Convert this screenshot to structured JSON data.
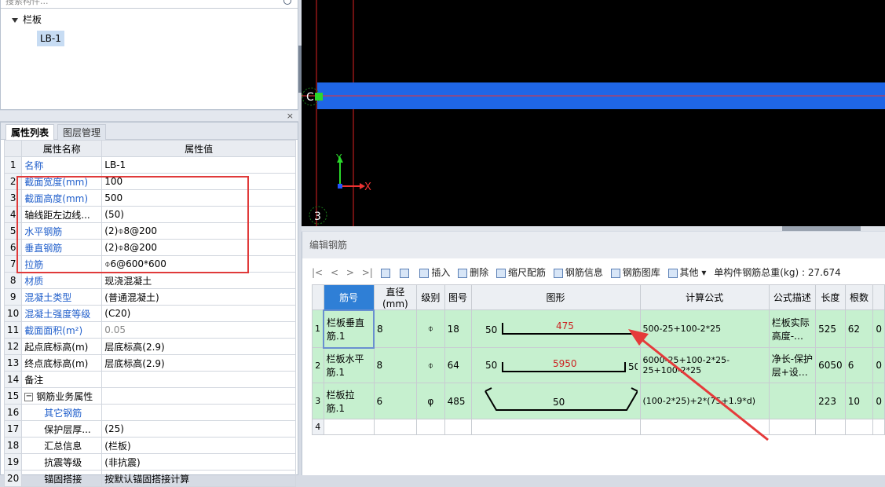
{
  "tree": {
    "search_placeholder": "搜索构件...",
    "root_label": "栏板",
    "child_label": "LB-1"
  },
  "props": {
    "tab_properties": "属性列表",
    "tab_layers": "图层管理",
    "col_name": "属性名称",
    "col_value": "属性值",
    "rows": [
      {
        "n": "1",
        "name": "名称",
        "value": "LB-1",
        "style": "blue"
      },
      {
        "n": "2",
        "name": "截面宽度(mm)",
        "value": "100",
        "style": "blue"
      },
      {
        "n": "3",
        "name": "截面高度(mm)",
        "value": "500",
        "style": "blue"
      },
      {
        "n": "4",
        "name": "轴线距左边线...",
        "value": "(50)",
        "style": ""
      },
      {
        "n": "5",
        "name": "水平钢筋",
        "value": "(2)⌽8@200",
        "style": "blue"
      },
      {
        "n": "6",
        "name": "垂直钢筋",
        "value": "(2)⌽8@200",
        "style": "blue"
      },
      {
        "n": "7",
        "name": "拉筋",
        "value": "⌽6@600*600",
        "style": "blue"
      },
      {
        "n": "8",
        "name": "材质",
        "value": "现浇混凝土",
        "style": "blue"
      },
      {
        "n": "9",
        "name": "混凝土类型",
        "value": "(普通混凝土)",
        "style": "blue"
      },
      {
        "n": "10",
        "name": "混凝土强度等级",
        "value": "(C20)",
        "style": "blue"
      },
      {
        "n": "11",
        "name": "截面面积(m²)",
        "value": "0.05",
        "style": "blue-gray"
      },
      {
        "n": "12",
        "name": "起点底标高(m)",
        "value": "层底标高(2.9)",
        "style": ""
      },
      {
        "n": "13",
        "name": "终点底标高(m)",
        "value": "层底标高(2.9)",
        "style": ""
      },
      {
        "n": "14",
        "name": "备注",
        "value": "",
        "style": ""
      },
      {
        "n": "15",
        "name": "钢筋业务属性",
        "value": "",
        "style": "group"
      },
      {
        "n": "16",
        "name": "其它钢筋",
        "value": "",
        "style": "blue-indent"
      },
      {
        "n": "17",
        "name": "保护层厚...",
        "value": "(25)",
        "style": "indent"
      },
      {
        "n": "18",
        "name": "汇总信息",
        "value": "(栏板)",
        "style": "indent"
      },
      {
        "n": "19",
        "name": "抗震等级",
        "value": "(非抗震)",
        "style": "indent"
      },
      {
        "n": "20",
        "name": "锚固搭接",
        "value": "按默认锚固搭接计算",
        "style": "indent"
      }
    ]
  },
  "cad": {
    "axis_y": "Y",
    "axis_x": "X",
    "grid_label_c": "C",
    "grid_label_3": "3"
  },
  "editor": {
    "title": "编辑钢筋",
    "nav": [
      "|<",
      "<",
      ">",
      ">|"
    ],
    "toolbar": {
      "insert": "插入",
      "delete": "删除",
      "scale": "缩尺配筋",
      "info": "钢筋信息",
      "library": "钢筋图库",
      "other": "其他",
      "total_label": "单构件钢筋总重(kg) : 27.674"
    },
    "columns": [
      "筋号",
      "直径(mm)",
      "级别",
      "图号",
      "图形",
      "计算公式",
      "公式描述",
      "长度",
      "根数"
    ],
    "rows": [
      {
        "n": "1",
        "name": "栏板垂直筋.1",
        "dia": "8",
        "grade": "⌽",
        "fig": "18",
        "shape_left": "50",
        "shape_mid": "475",
        "shape_right": "",
        "formula": "500-25+100-2*25",
        "desc": "栏板实际高度-…",
        "len": "525",
        "count": "62",
        "extra": "0"
      },
      {
        "n": "2",
        "name": "栏板水平筋.1",
        "dia": "8",
        "grade": "⌽",
        "fig": "64",
        "shape_left": "50",
        "shape_mid": "5950",
        "shape_right": "50",
        "formula": "6000-25+100-2*25-25+100-2*25",
        "desc": "净长-保护层+设…",
        "len": "6050",
        "count": "6",
        "extra": "0"
      },
      {
        "n": "3",
        "name": "栏板拉筋.1",
        "dia": "6",
        "grade": "φ",
        "fig": "485",
        "shape_left": "",
        "shape_mid": "50",
        "shape_right": "",
        "formula": "(100-2*25)+2*(75+1.9*d)",
        "desc": "",
        "len": "223",
        "count": "10",
        "extra": "0"
      },
      {
        "n": "4",
        "name": "",
        "dia": "",
        "grade": "",
        "fig": "",
        "shape_left": "",
        "shape_mid": "",
        "shape_right": "",
        "formula": "",
        "desc": "",
        "len": "",
        "count": "",
        "extra": ""
      }
    ]
  },
  "colors": {
    "accent": "#2f7fd6",
    "highlight_box": "#e03a3a",
    "row_green": "#c6f0cf",
    "cad_beam": "#1f66e6"
  }
}
